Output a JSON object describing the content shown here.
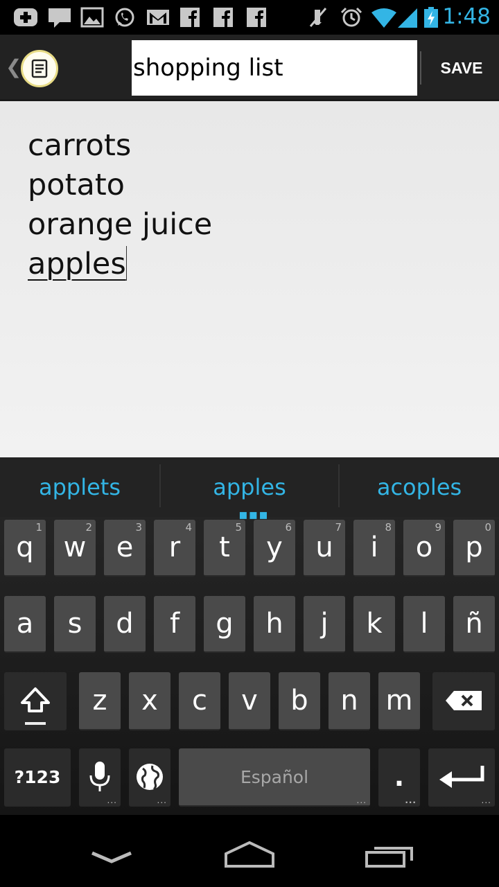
{
  "status_bar": {
    "clock": "1:48",
    "left_icons": [
      "plus-icon",
      "message-icon",
      "gallery-icon",
      "whatsapp-icon",
      "gmail-icon",
      "facebook-icon",
      "facebook-icon",
      "facebook-icon"
    ],
    "right_icons": [
      "mute-icon",
      "alarm-icon",
      "wifi-icon",
      "signal-icon",
      "battery-charging-icon"
    ],
    "accent_color": "#33b5e5"
  },
  "action_bar": {
    "title_value": "shopping list",
    "save_label": "SAVE",
    "app_icon": "note-icon"
  },
  "note": {
    "lines": [
      "carrots",
      "potato",
      "orange juice"
    ],
    "current_word": "apples"
  },
  "keyboard": {
    "suggestions": [
      "applets",
      "apples",
      "acoples"
    ],
    "row1": [
      {
        "label": "q",
        "hint": "1"
      },
      {
        "label": "w",
        "hint": "2"
      },
      {
        "label": "e",
        "hint": "3"
      },
      {
        "label": "r",
        "hint": "4"
      },
      {
        "label": "t",
        "hint": "5"
      },
      {
        "label": "y",
        "hint": "6"
      },
      {
        "label": "u",
        "hint": "7"
      },
      {
        "label": "i",
        "hint": "8"
      },
      {
        "label": "o",
        "hint": "9"
      },
      {
        "label": "p",
        "hint": "0"
      }
    ],
    "row2": [
      "a",
      "s",
      "d",
      "f",
      "g",
      "h",
      "j",
      "k",
      "l",
      "ñ"
    ],
    "row3": [
      "z",
      "x",
      "c",
      "v",
      "b",
      "n",
      "m"
    ],
    "symbols_label": "?123",
    "space_label": "Español",
    "period_label": ".",
    "more_indicator": "..."
  },
  "nav_bar": {
    "items": [
      "back-icon",
      "home-icon",
      "recents-icon"
    ]
  }
}
